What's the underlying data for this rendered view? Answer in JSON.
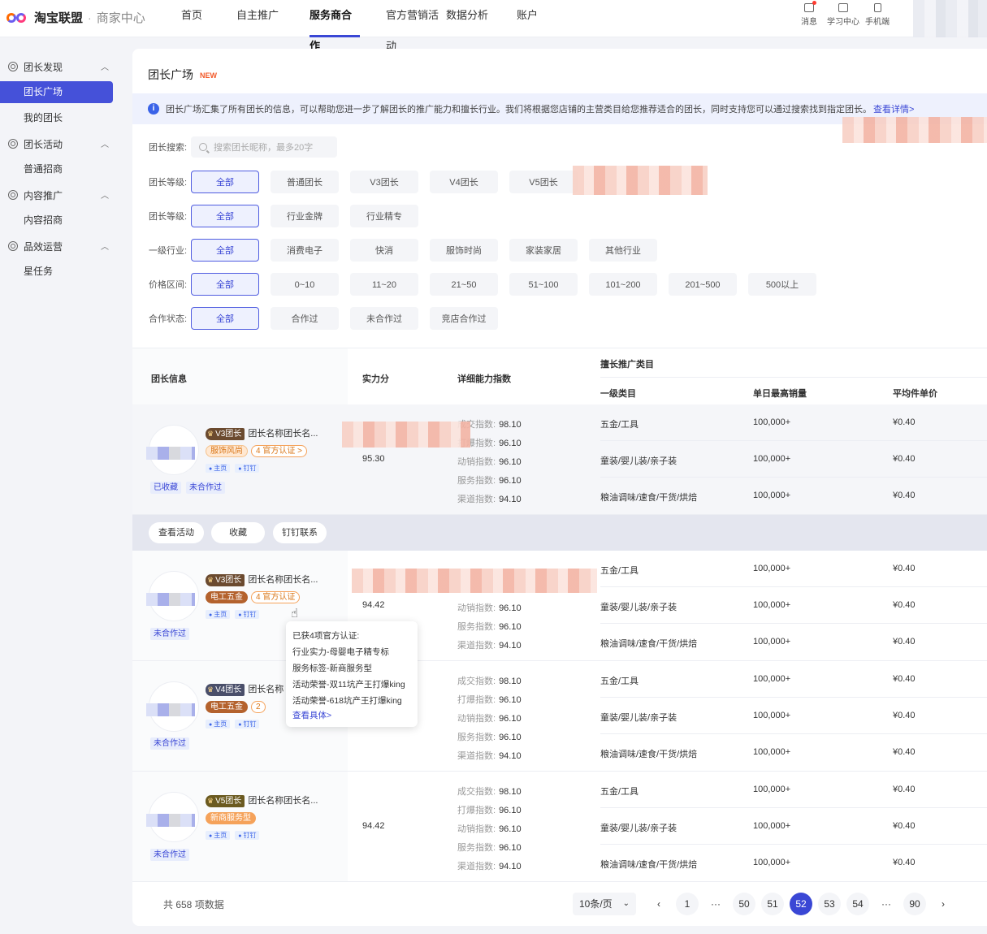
{
  "brand": {
    "name": "淘宝联盟",
    "sub": "商家中心",
    "sep": "·"
  },
  "nav": [
    "首页",
    "自主推广",
    "服务商合作",
    "官方营销活动",
    "数据分析",
    "账户"
  ],
  "top_right": [
    "消息",
    "学习中心",
    "手机端"
  ],
  "sidebar": {
    "groups": [
      "团长发现",
      "团长活动",
      "内容推广",
      "品效运营"
    ],
    "items": [
      "团长广场",
      "我的团长",
      "普通招商",
      "内容招商",
      "星任务"
    ]
  },
  "page": {
    "title": "团长广场",
    "badge": "NEW"
  },
  "notice": {
    "text": "团长广场汇集了所有团长的信息，可以帮助您进一步了解团长的推广能力和擅长行业。我们将根据您店铺的主营类目给您推荐适合的团长，同时支持您可以通过搜索找到指定团长。",
    "link": "查看详情>",
    "icon": "i"
  },
  "filters": {
    "search_label": "团长搜索:",
    "search_placeholder": "搜索团长昵称，最多20字",
    "rows": [
      {
        "label": "团长等级:",
        "options": [
          "全部",
          "普通团长",
          "V3团长",
          "V4团长",
          "V5团长"
        ]
      },
      {
        "label": "团长等级:",
        "options": [
          "全部",
          "行业金牌",
          "行业精专"
        ]
      },
      {
        "label": "一级行业:",
        "options": [
          "全部",
          "消费电子",
          "快消",
          "服饰时尚",
          "家装家居",
          "其他行业"
        ]
      },
      {
        "label": "价格区间:",
        "options": [
          "全部",
          "0~10",
          "11~20",
          "21~50",
          "51~100",
          "101~200",
          "201~500",
          "500以上"
        ]
      },
      {
        "label": "合作状态:",
        "options": [
          "全部",
          "合作过",
          "未合作过",
          "竞店合作过"
        ]
      }
    ]
  },
  "table": {
    "headers": {
      "info": "团长信息",
      "score": "实力分",
      "metrics": "详细能力指数",
      "category_group": "擅长推广类目",
      "cat": "一级类目",
      "sales": "单日最高销量",
      "price": "平均件单价"
    },
    "metric_names": [
      "成交指数:",
      "打爆指数:",
      "动销指数:",
      "服务指数:",
      "渠道指数:"
    ],
    "metric_values": [
      "98.10",
      "96.10",
      "96.10",
      "96.10",
      "94.10"
    ],
    "categories": [
      {
        "cat": "五金/工具",
        "sales": "100,000+",
        "price": "¥0.40"
      },
      {
        "cat": "童装/婴儿装/亲子装",
        "sales": "100,000+",
        "price": "¥0.40"
      },
      {
        "cat": "粮油调味/速食/干货/烘焙",
        "sales": "100,000+",
        "price": "¥0.40"
      }
    ],
    "rows": [
      {
        "level": "V3团长",
        "name": "团长名称团长名...",
        "tag": "服饰风尚",
        "cert": "4 官方认证 >",
        "mini": [
          "主页",
          "钉钉"
        ],
        "status": [
          "已收藏",
          "未合作过"
        ],
        "score": "95.30"
      },
      {
        "level": "V3团长",
        "name": "团长名称团长名...",
        "tag": "电工五金",
        "cert": "4 官方认证",
        "mini": [
          "主页",
          "钉钉"
        ],
        "status": [
          "未合作过"
        ],
        "score": "94.42"
      },
      {
        "level": "V4团长",
        "name": "团长名称",
        "tag": "电工五金",
        "cert": "2",
        "mini": [
          "主页",
          "钉钉"
        ],
        "status": [
          "未合作过"
        ],
        "score": ""
      },
      {
        "level": "V5团长",
        "name": "团长名称团长名...",
        "tag": "新商服务型",
        "cert": "",
        "mini": [
          "主页",
          "钉钉"
        ],
        "status": [
          "未合作过"
        ],
        "score": "94.42"
      }
    ],
    "actions": [
      "查看活动",
      "收藏",
      "钉钉联系"
    ]
  },
  "tooltip": {
    "lines": [
      "已获4项官方认证:",
      "行业实力-母婴电子精专标",
      "服务标签-新商服务型",
      "活动荣誉-双11坑产王打爆king",
      "活动荣誉-618坑产王打爆king"
    ],
    "link": "查看具体>"
  },
  "footer": {
    "total": "共 658 项数据",
    "page_size": "10条/页",
    "pages": [
      "‹",
      "1",
      "···",
      "50",
      "51",
      "52",
      "53",
      "54",
      "···",
      "90",
      "›"
    ],
    "current": "52"
  },
  "colors": {
    "accent": "#3a47d5",
    "highlight": "#4551d9",
    "new_badge": "#f25a2a"
  }
}
